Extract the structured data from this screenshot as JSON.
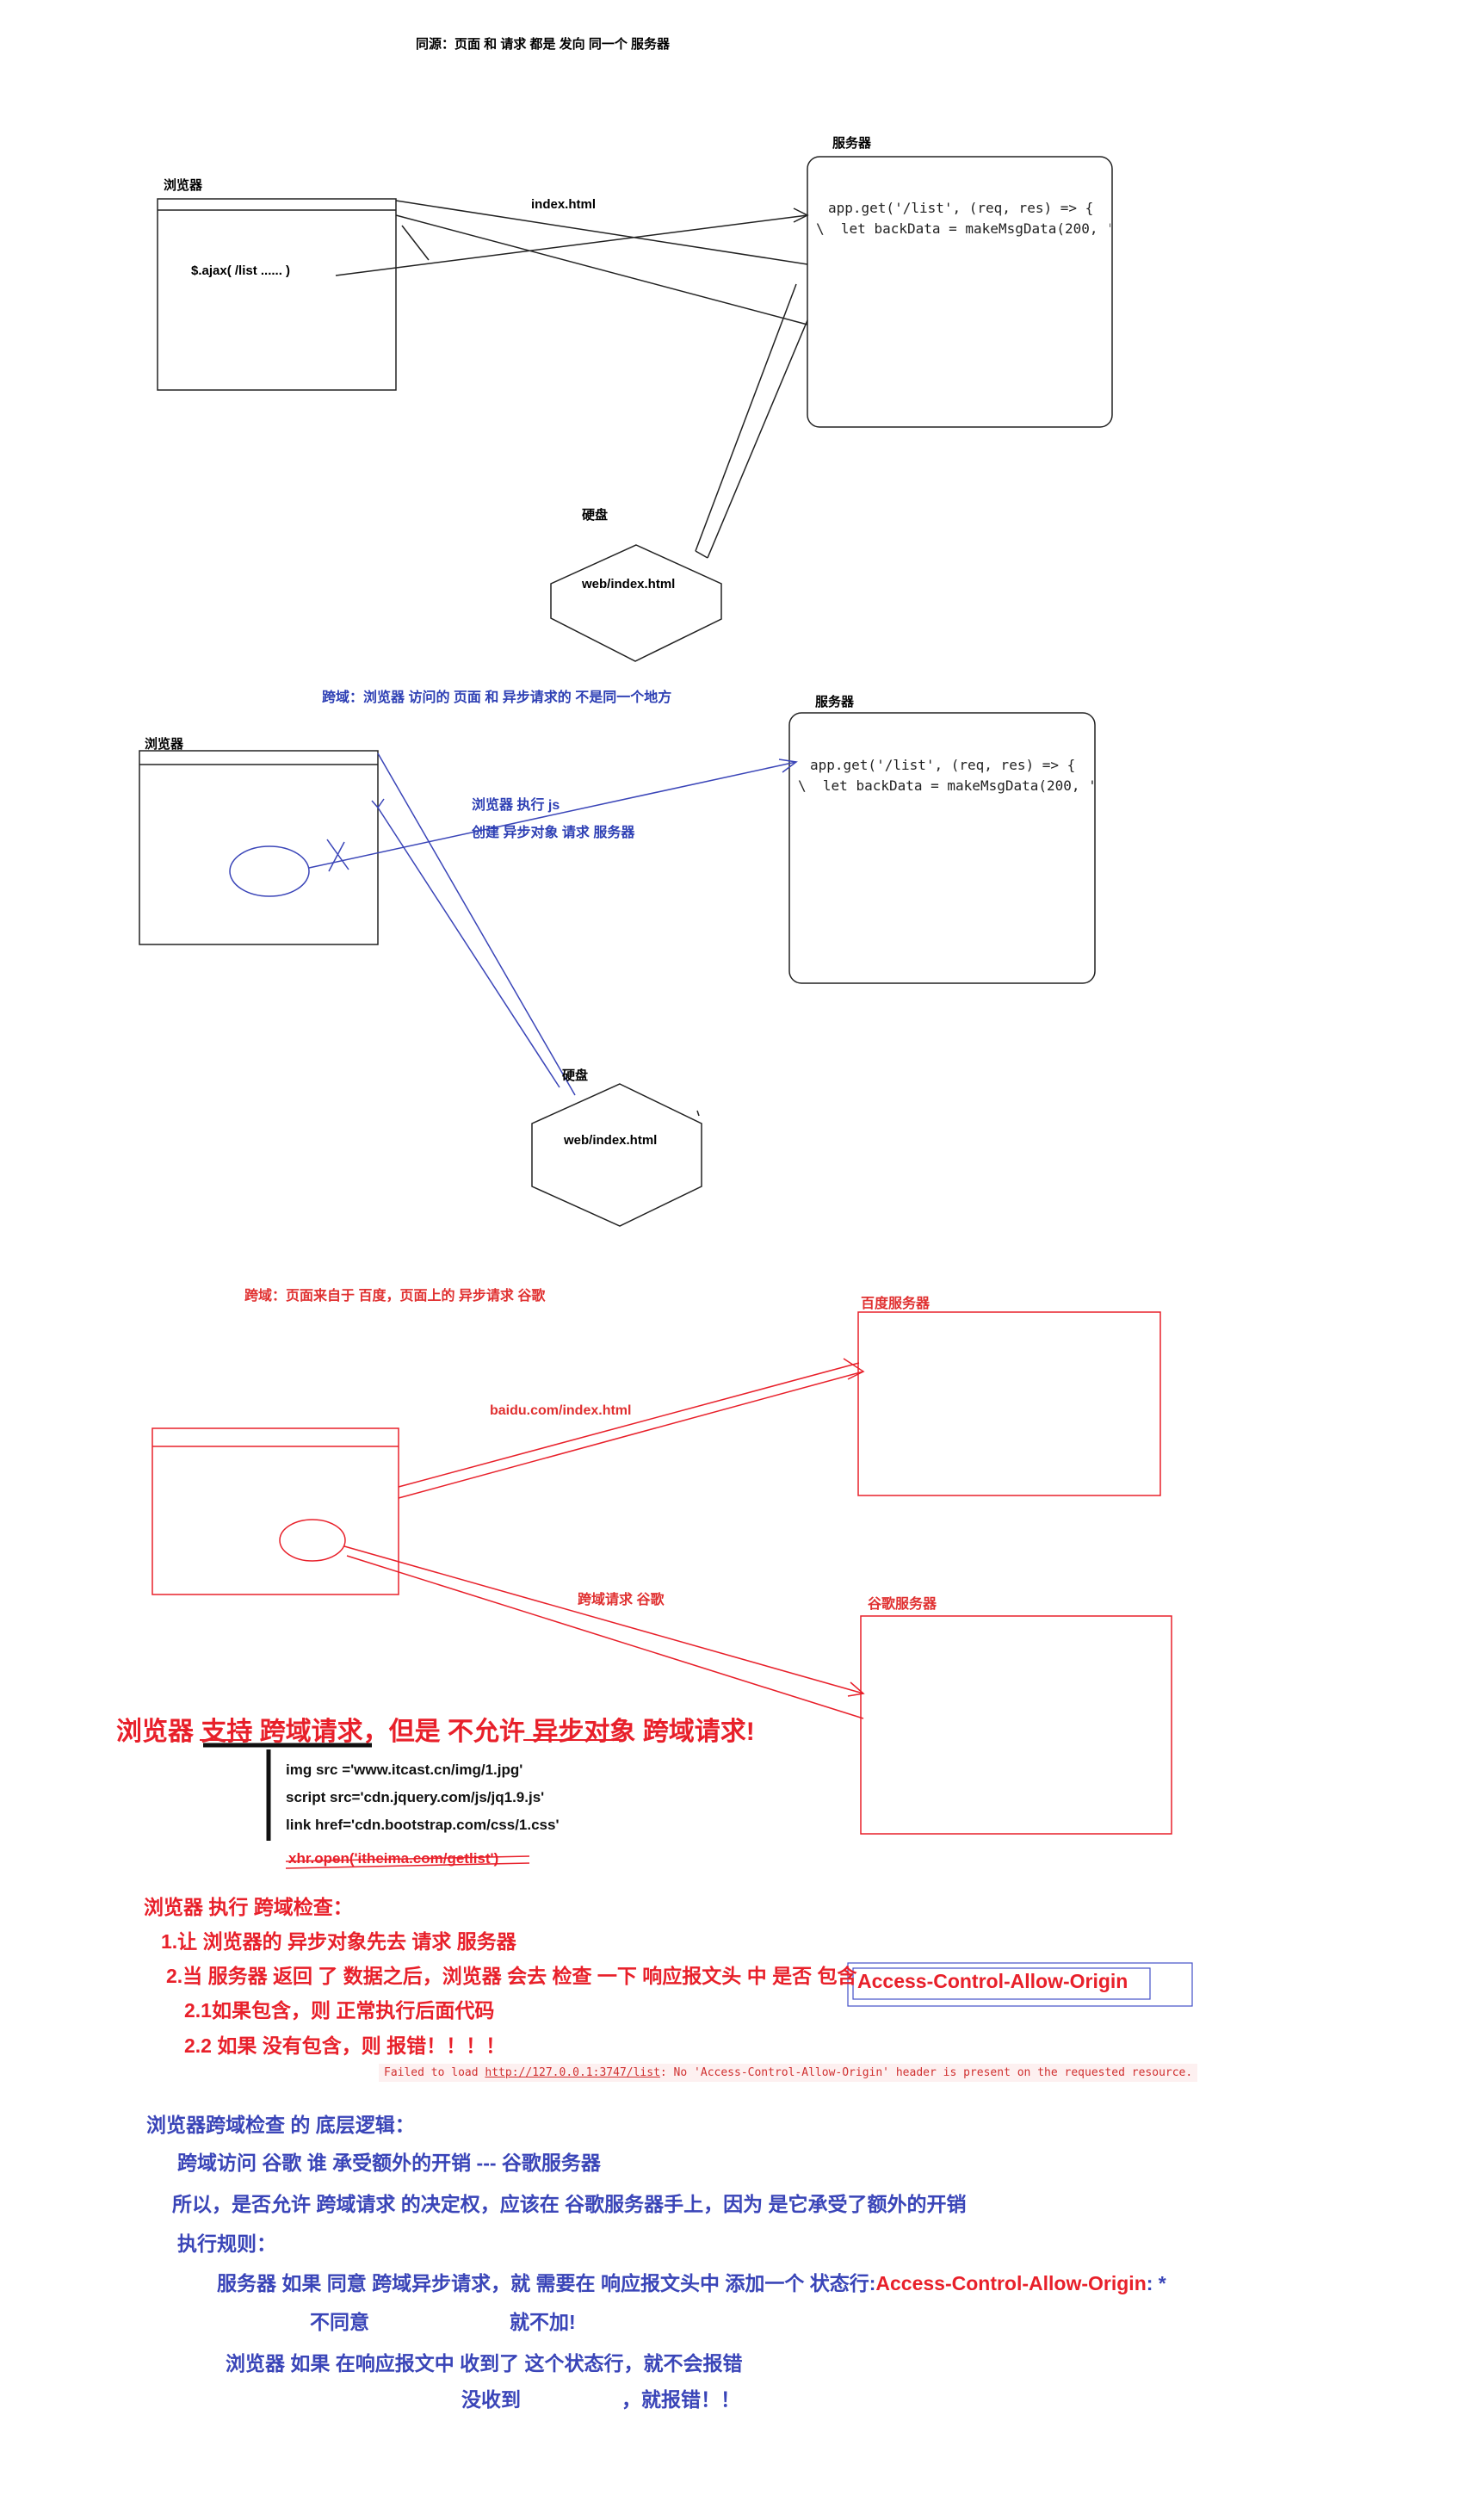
{
  "section1": {
    "title": "同源：页面 和 请求 都是 发向 同一个 服务器",
    "browser_label": "浏览器",
    "server_label": "服务器",
    "disk_label": "硬盘",
    "arrow_label": "index.html",
    "ajax_call": "$.ajax(   /list   ...... )",
    "disk_file": "web/index.html",
    "code_line1": "app.get('/list', (req, res) => {",
    "code_line2": "  let backData = makeMsgData(200, '",
    "code_marker": "\\"
  },
  "section2": {
    "title": "跨域：浏览器 访问的 页面 和 异步请求的 不是同一个地方",
    "browser_label": "浏览器",
    "server_label": "服务器",
    "disk_label": "硬盘",
    "note_line1": "浏览器 执行 js",
    "note_line2": "创建  异步对象 请求 服务器",
    "disk_file": "web/index.html",
    "code_line1": "app.get('/list', (req, res) => {",
    "code_line2": "  let backData = makeMsgData(200, '",
    "code_marker": "\\"
  },
  "section3": {
    "title": "跨域：页面来自于 百度，页面上的 异步请求 谷歌",
    "baidu_label": "百度服务器",
    "google_label": "谷歌服务器",
    "baidu_arrow_label": "baidu.com/index.html",
    "google_arrow_label": "跨域请求 谷歌"
  },
  "headline": {
    "p1": "浏览器 ",
    "p2": "支持",
    "p3": " 跨域请求，但是 不允许 ",
    "p4": "异步对象",
    "p5": " 跨域请求!"
  },
  "examples": [
    "img src ='www.itcast.cn/img/1.jpg'",
    "script src='cdn.jquery.com/js/jq1.9.js'",
    "link href='cdn.bootstrap.com/css/1.css'"
  ],
  "xhr_example": "xhr.open('itheima.com/getlist')",
  "check": {
    "title": "浏览器 执行 跨域检查：",
    "step1": "1.让 浏览器的 异步对象先去 请求 服务器",
    "step2": "2.当 服务器 返回 了 数据之后，浏览器 会去 检查 一下 响应报文头 中 是否 包含",
    "header_name": "Access-Control-Allow-Origin",
    "step21": "2.1如果包含，则 正常执行后面代码",
    "step22": "2.2 如果 没有包含，则 报错！！！！"
  },
  "error": {
    "prefix": "Failed to load ",
    "url": "http://127.0.0.1:3747/list",
    "suffix": ": No 'Access-Control-Allow-Origin' header is present on the requested resource."
  },
  "logic": {
    "title": "浏览器跨域检查 的 底层逻辑：",
    "line1": "跨域访问 谷歌  谁 承受额外的开销 --- 谷歌服务器",
    "line2": "所以，是否允许 跨域请求 的决定权，应该在 谷歌服务器手上，因为 是它承受了额外的开销",
    "rules_title": "执行规则：",
    "rule1": "服务器 如果 同意 跨域异步请求，就 需要在 响应报文头中 添加一个 状态行:",
    "rule1_header": "Access-Control-Allow-Origin",
    "rule1_value": ": *",
    "rule1b_a": "不同意",
    "rule1b_b": "就不加!",
    "rule2": "浏览器 如果 在响应报文中 收到了 这个状态行，就不会报错",
    "rule2b_a": "没收到",
    "rule2b_b": "，就报错！！"
  },
  "colors": {
    "red": "#e8202a",
    "blue": "#3a45b8",
    "black": "#111111"
  }
}
